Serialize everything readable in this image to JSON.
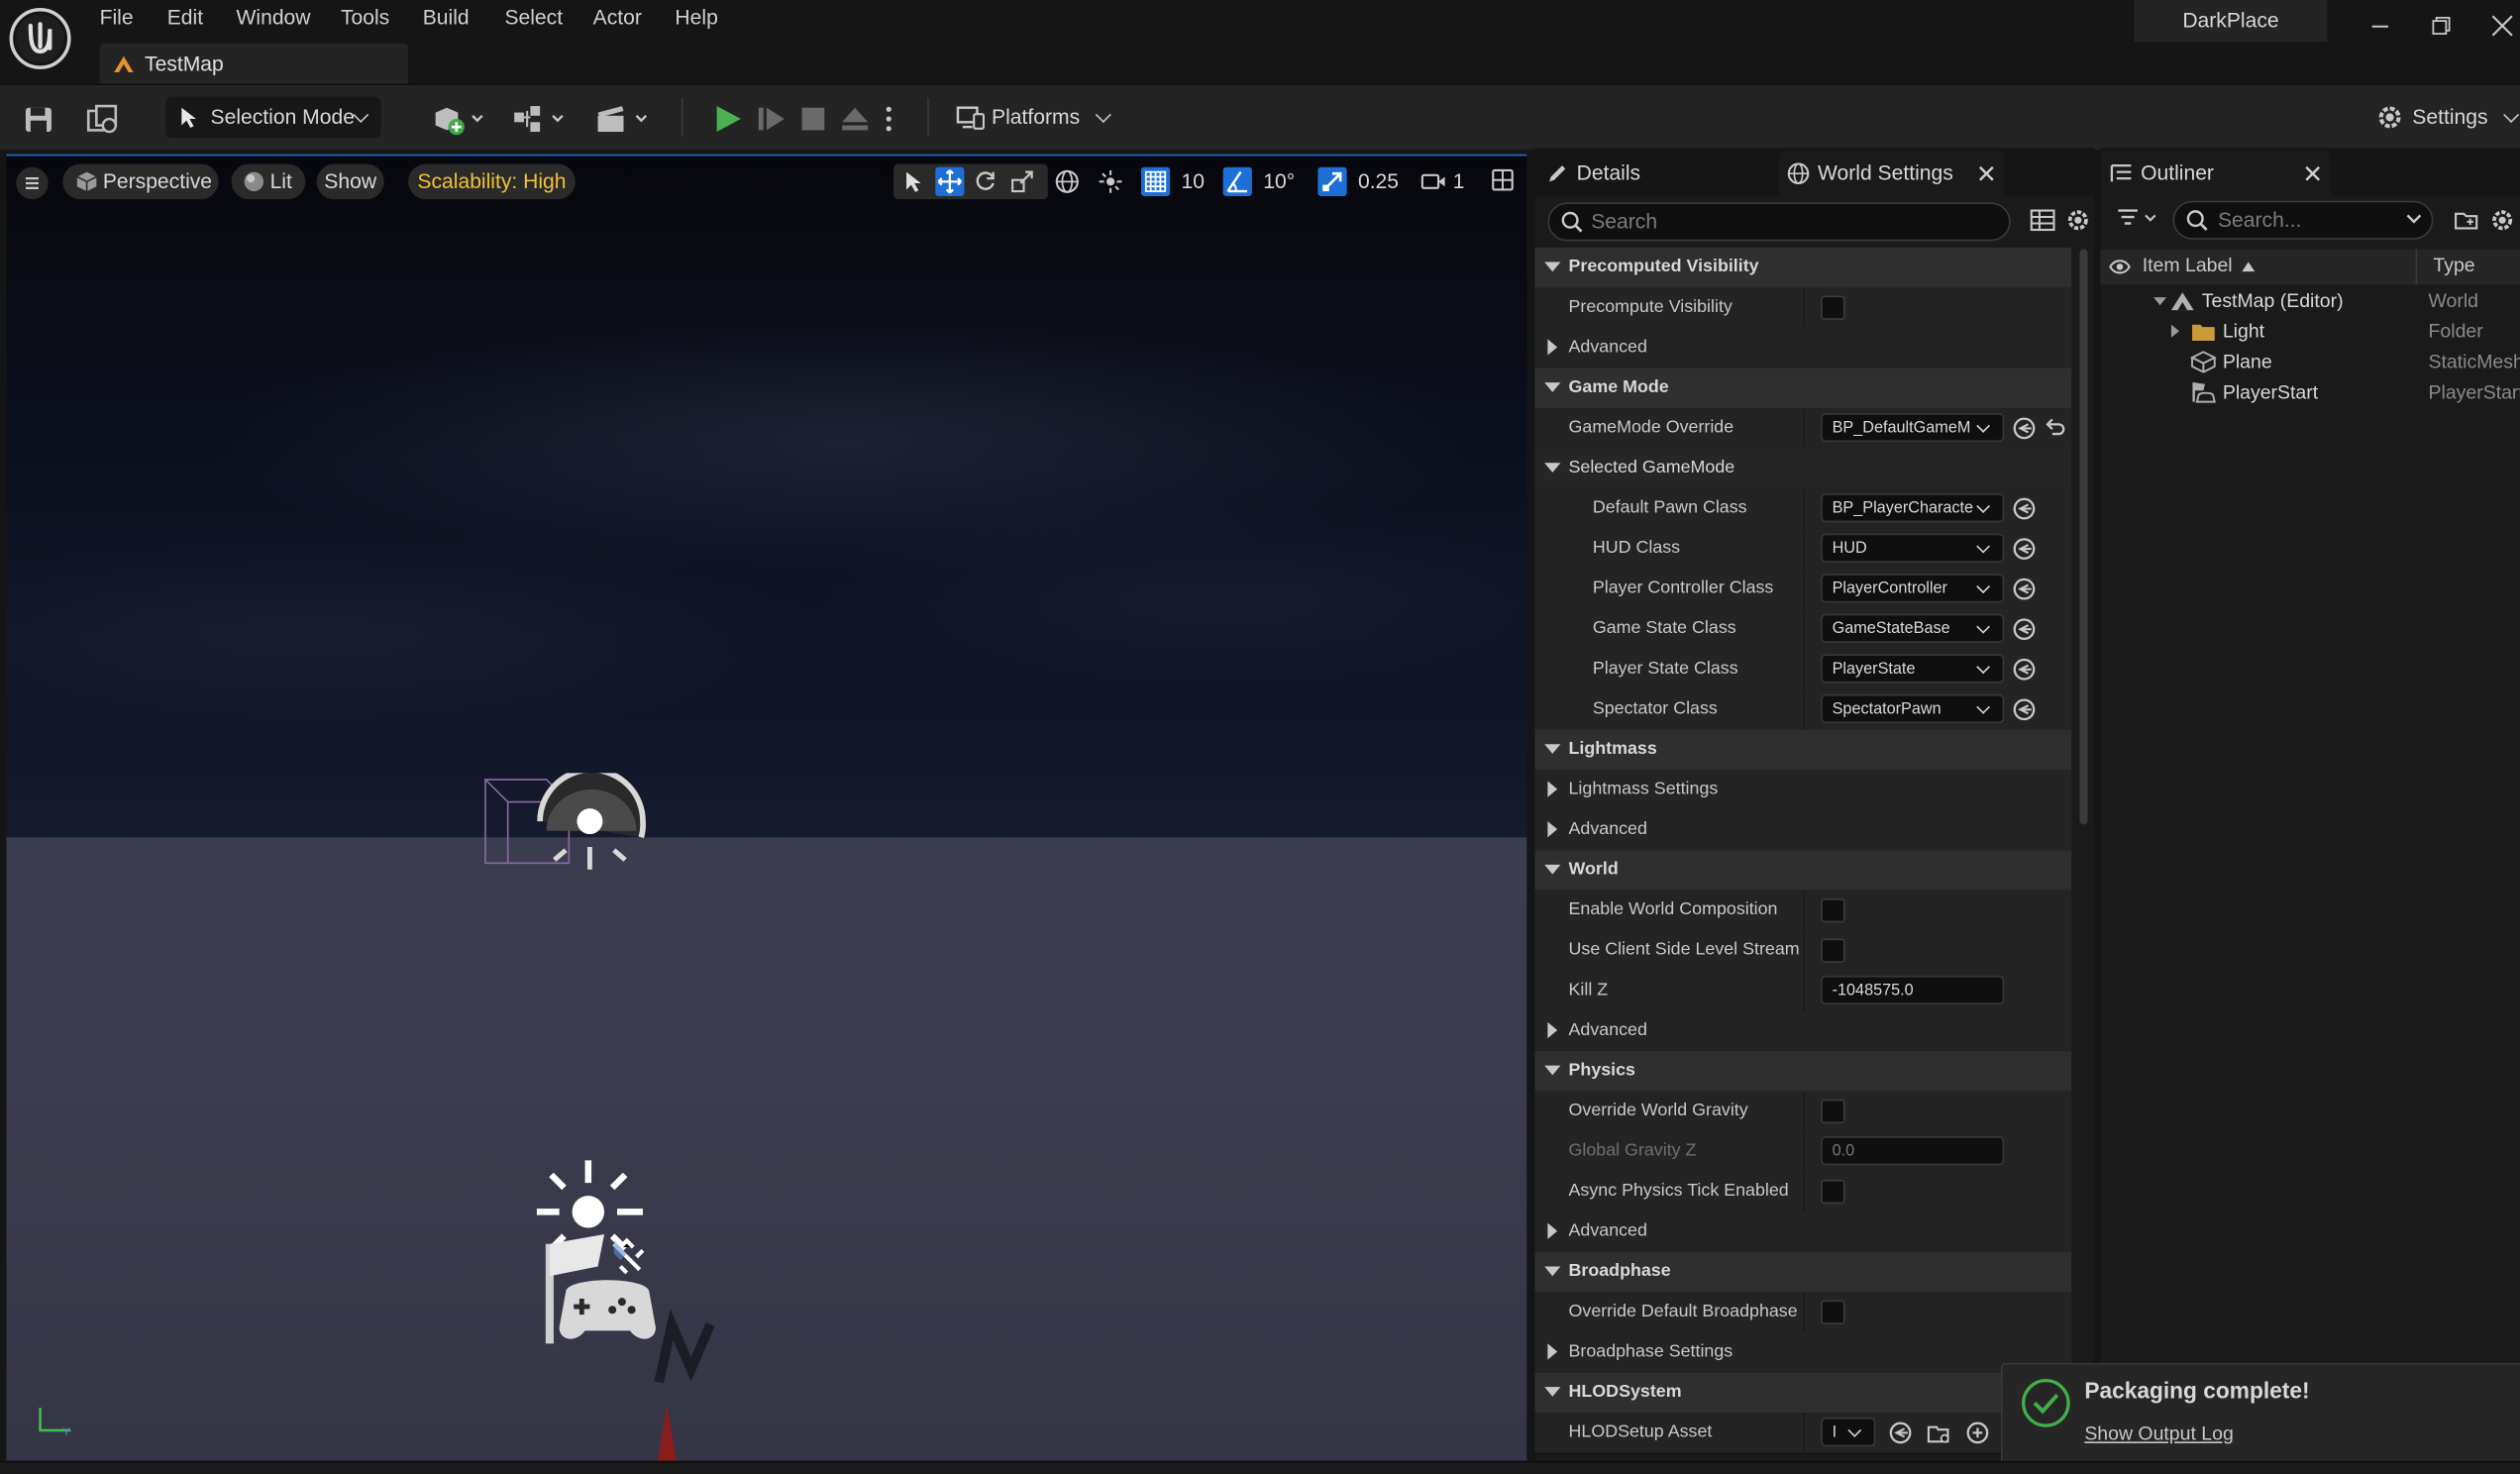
{
  "app": {
    "project_name": "DarkPlace",
    "map_tab": "TestMap"
  },
  "menu": [
    "File",
    "Edit",
    "Window",
    "Tools",
    "Build",
    "Select",
    "Actor",
    "Help"
  ],
  "toolbar": {
    "selection_mode": "Selection Mode",
    "platforms": "Platforms",
    "settings": "Settings"
  },
  "viewport": {
    "perspective": "Perspective",
    "lit": "Lit",
    "show": "Show",
    "scalability": "Scalability: High",
    "grid_snap": "10",
    "rotation_snap": "10°",
    "scale_snap": "0.25",
    "camera_speed": "1"
  },
  "details": {
    "tab_details": "Details",
    "tab_world_settings": "World Settings",
    "search_placeholder": "Search",
    "rows": [
      {
        "label": "Precomputed Visibility",
        "kind": "category"
      },
      {
        "label": "Precompute Visibility",
        "kind": "checkbox"
      },
      {
        "label": "Advanced",
        "kind": "collapsed"
      },
      {
        "label": "Game Mode",
        "kind": "category"
      },
      {
        "label": "GameMode Override",
        "kind": "combo",
        "value": "BP_DefaultGameM",
        "reset": true,
        "revert": true
      },
      {
        "label": "Selected GameMode",
        "kind": "subcategory"
      },
      {
        "label": "Default Pawn Class",
        "kind": "combo",
        "value": "BP_PlayerCharacte",
        "reset": true,
        "indent": true
      },
      {
        "label": "HUD Class",
        "kind": "combo",
        "value": "HUD",
        "reset": true,
        "indent": true
      },
      {
        "label": "Player Controller Class",
        "kind": "combo",
        "value": "PlayerController",
        "reset": true,
        "indent": true
      },
      {
        "label": "Game State Class",
        "kind": "combo",
        "value": "GameStateBase",
        "reset": true,
        "indent": true
      },
      {
        "label": "Player State Class",
        "kind": "combo",
        "value": "PlayerState",
        "reset": true,
        "indent": true
      },
      {
        "label": "Spectator Class",
        "kind": "combo",
        "value": "SpectatorPawn",
        "reset": true,
        "indent": true
      },
      {
        "label": "Lightmass",
        "kind": "category"
      },
      {
        "label": "Lightmass Settings",
        "kind": "collapsed"
      },
      {
        "label": "Advanced",
        "kind": "collapsed"
      },
      {
        "label": "World",
        "kind": "category"
      },
      {
        "label": "Enable World Composition",
        "kind": "checkbox"
      },
      {
        "label": "Use Client Side Level Streamin...",
        "kind": "checkbox"
      },
      {
        "label": "Kill Z",
        "kind": "number",
        "value": "-1048575.0"
      },
      {
        "label": "Advanced",
        "kind": "collapsed"
      },
      {
        "label": "Physics",
        "kind": "category"
      },
      {
        "label": "Override World Gravity",
        "kind": "checkbox"
      },
      {
        "label": "Global Gravity Z",
        "kind": "number",
        "value": "0.0",
        "disabled": true
      },
      {
        "label": "Async Physics Tick Enabled",
        "kind": "checkbox"
      },
      {
        "label": "Advanced",
        "kind": "collapsed"
      },
      {
        "label": "Broadphase",
        "kind": "category"
      },
      {
        "label": "Override Default Broadphase S...",
        "kind": "checkbox"
      },
      {
        "label": "Broadphase Settings",
        "kind": "collapsed"
      },
      {
        "label": "HLODSystem",
        "kind": "category"
      },
      {
        "label": "HLODSetup Asset",
        "kind": "asset",
        "value": "I"
      }
    ]
  },
  "outliner": {
    "title": "Outliner",
    "search_placeholder": "Search...",
    "col_label": "Item Label",
    "col_type": "Type",
    "items": [
      {
        "label": "TestMap (Editor)",
        "type": "World",
        "level": 0,
        "icon": "world-icon"
      },
      {
        "label": "Light",
        "type": "Folder",
        "level": 1,
        "icon": "folder-icon"
      },
      {
        "label": "Plane",
        "type": "StaticMesh",
        "level": 1,
        "icon": "mesh-icon"
      },
      {
        "label": "PlayerStart",
        "type": "PlayerStart",
        "level": 1,
        "icon": "player-start-icon"
      }
    ]
  },
  "toast": {
    "title": "Packaging complete!",
    "link": "Show Output Log"
  },
  "colors": {
    "accent_blue": "#1d6fd8",
    "play_green": "#4caf50",
    "scalability_yellow": "#f1c232",
    "success_green": "#41b04a"
  }
}
